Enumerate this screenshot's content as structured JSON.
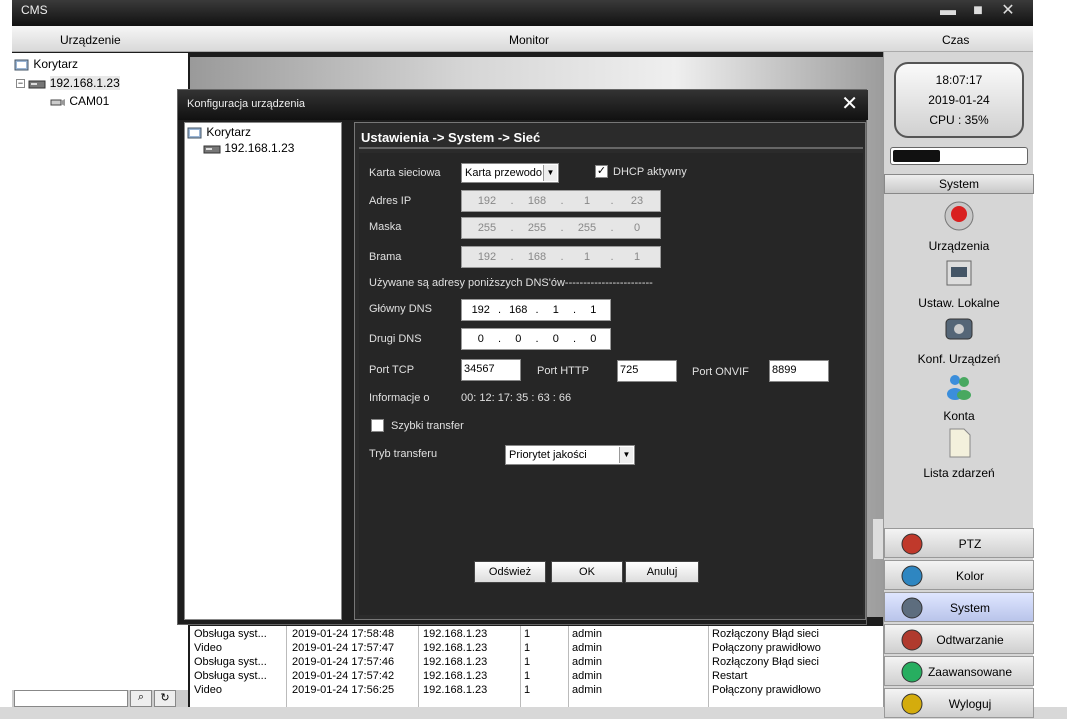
{
  "window": {
    "title": "CMS"
  },
  "header": {
    "device": "Urządzenie",
    "monitor": "Monitor",
    "time": "Czas"
  },
  "tree": {
    "root": "Korytarz",
    "device": "192.168.1.23",
    "camera": "CAM01"
  },
  "clock": {
    "time": "18:07:17",
    "date": "2019-01-24",
    "cpu": "CPU : 35%"
  },
  "cpu_usage": 0.35,
  "side": {
    "section_title": "System",
    "items": [
      {
        "label": "Urządzenia",
        "icon": "devices-icon"
      },
      {
        "label": "Ustaw. Lokalne",
        "icon": "local-settings-icon"
      },
      {
        "label": "Konf. Urządzeń",
        "icon": "device-config-icon"
      },
      {
        "label": "Konta",
        "icon": "accounts-icon"
      },
      {
        "label": "Lista zdarzeń",
        "icon": "event-list-icon"
      }
    ],
    "menu": [
      {
        "label": "PTZ",
        "icon": "ptz-icon"
      },
      {
        "label": "Kolor",
        "icon": "color-icon"
      },
      {
        "label": "System",
        "icon": "system-icon"
      },
      {
        "label": "Odtwarzanie",
        "icon": "playback-icon"
      },
      {
        "label": "Zaawansowane",
        "icon": "advanced-icon"
      },
      {
        "label": "Wyloguj",
        "icon": "logout-icon"
      }
    ]
  },
  "log": [
    {
      "type": "Obsługa syst...",
      "time": "2019-01-24 17:58:48",
      "ip": "192.168.1.23",
      "ch": "1",
      "user": "admin",
      "msg": "Rozłączony Błąd sieci"
    },
    {
      "type": "Video",
      "time": "2019-01-24 17:57:47",
      "ip": "192.168.1.23",
      "ch": "1",
      "user": "admin",
      "msg": "Połączony prawidłowo"
    },
    {
      "type": "Obsługa syst...",
      "time": "2019-01-24 17:57:46",
      "ip": "192.168.1.23",
      "ch": "1",
      "user": "admin",
      "msg": "Rozłączony Błąd sieci"
    },
    {
      "type": "Obsługa syst...",
      "time": "2019-01-24 17:57:42",
      "ip": "192.168.1.23",
      "ch": "1",
      "user": "admin",
      "msg": "Restart"
    },
    {
      "type": "Video",
      "time": "2019-01-24 17:56:25",
      "ip": "192.168.1.23",
      "ch": "1",
      "user": "admin",
      "msg": "Połączony prawidłowo"
    }
  ],
  "dialog": {
    "title": "Konfiguracja urządzenia",
    "tree_root": "Korytarz",
    "tree_device": "192.168.1.23",
    "breadcrumb": "Ustawienia -> System -> Sieć",
    "nic_label": "Karta sieciowa",
    "nic_value": "Karta przewodo",
    "dhcp_label": "DHCP aktywny",
    "dhcp_checked": true,
    "ip_label": "Adres IP",
    "ip": [
      "192",
      "168",
      "1",
      "23"
    ],
    "mask_label": "Maska",
    "mask": [
      "255",
      "255",
      "255",
      "0"
    ],
    "gateway_label": "Brama",
    "gateway": [
      "192",
      "168",
      "1",
      "1"
    ],
    "dns_note": "Używane są adresy poniższych DNS'ów------------------------",
    "dns1_label": "Główny DNS",
    "dns1": [
      "192",
      "168",
      "1",
      "1"
    ],
    "dns2_label": "Drugi DNS",
    "dns2": [
      "0",
      "0",
      "0",
      "0"
    ],
    "tcp_label": "Port TCP",
    "tcp_value": "34567",
    "http_label": "Port HTTP",
    "http_value": "725",
    "onvif_label": "Port ONVIF",
    "onvif_value": "8899",
    "info_label": "Informacje o",
    "mac": "00:  12:  17:  35  :  63  :  66",
    "fast_label": "Szybki transfer",
    "fast_checked": false,
    "mode_label": "Tryb transferu",
    "mode_value": "Priorytet jakości",
    "refresh": "Odśwież",
    "ok": "OK",
    "cancel": "Anuluj"
  }
}
